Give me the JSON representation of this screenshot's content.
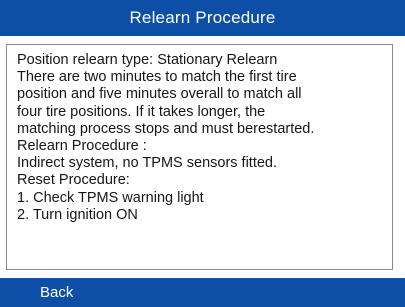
{
  "header": {
    "title": "Relearn Procedure"
  },
  "content": {
    "lines": [
      "Position relearn type: Stationary Relearn",
      "There are two minutes to match the first tire",
      "position and five minutes overall to match all",
      "four tire positions. If it takes longer, the",
      "matching process stops and must berestarted.",
      "Relearn Procedure :",
      "Indirect system, no TPMS sensors fitted.",
      "Reset Procedure:",
      "1. Check TPMS warning light",
      "2. Turn ignition ON"
    ]
  },
  "footer": {
    "back_label": "Back"
  },
  "colors": {
    "bar": "#0d4fa6",
    "bar_text": "#ffffff",
    "body_text": "#161616",
    "panel_border": "#8c8c8c"
  }
}
